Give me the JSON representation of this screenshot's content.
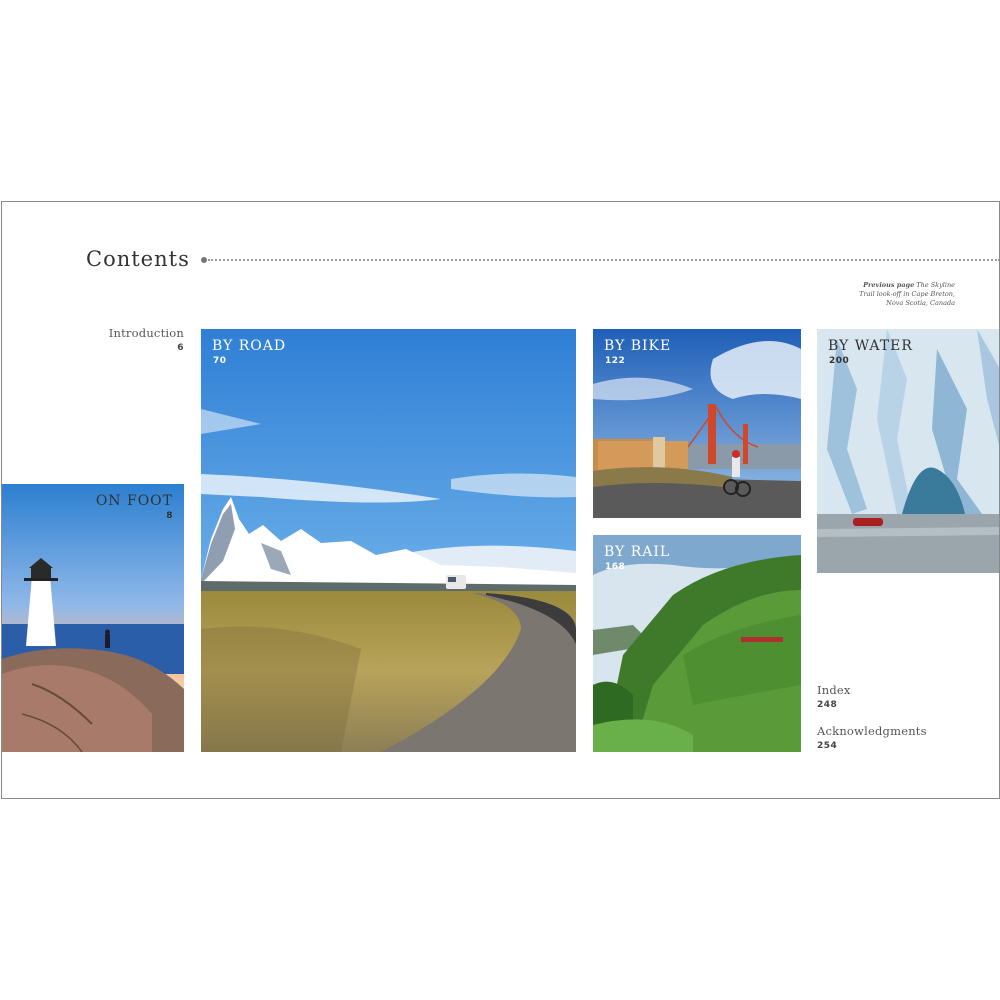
{
  "heading": "Contents",
  "caption": {
    "bold": "Previous page",
    "line1": "The Skyline",
    "line2": "Trail look-off in Cape Breton,",
    "line3": "Nova Scotia, Canada"
  },
  "toc": {
    "introduction": {
      "label": "Introduction",
      "page": "6"
    },
    "index": {
      "label": "Index",
      "page": "248"
    },
    "acknowledgments": {
      "label": "Acknowledgments",
      "page": "254"
    }
  },
  "sections": {
    "foot": {
      "label": "ON FOOT",
      "page": "8"
    },
    "road": {
      "label": "BY ROAD",
      "page": "70"
    },
    "bike": {
      "label": "BY BIKE",
      "page": "122"
    },
    "rail": {
      "label": "BY RAIL",
      "page": "168"
    },
    "water": {
      "label": "BY WATER",
      "page": "200"
    }
  }
}
